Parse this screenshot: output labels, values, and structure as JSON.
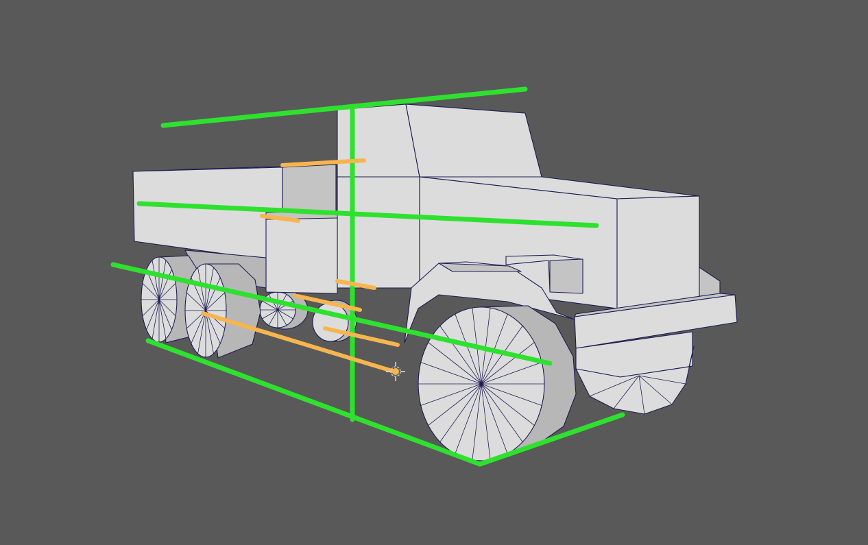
{
  "viewport": {
    "background": "#595959",
    "object": "truck-lowpoly-model",
    "mesh_fill": "#dcdcdc",
    "wire_color": "#1c1c52"
  },
  "overlays": {
    "guide_line_color": "#2fe12f",
    "vanishing_line_color": "#f7b54f",
    "cursor_icon": "3d-cursor-icon"
  }
}
